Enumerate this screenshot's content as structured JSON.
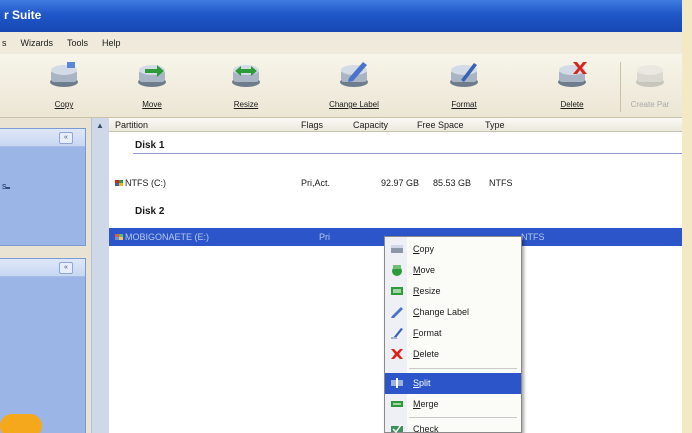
{
  "window": {
    "title": "r Suite"
  },
  "menu": {
    "items": [
      "s",
      "Wizards",
      "Tools",
      "Help"
    ]
  },
  "toolbar": {
    "buttons": [
      {
        "label": "Copy",
        "icon": "copy-icon"
      },
      {
        "label": "Move",
        "icon": "move-icon"
      },
      {
        "label": "Resize",
        "icon": "resize-icon"
      },
      {
        "label": "Change Label",
        "icon": "change-label-icon"
      },
      {
        "label": "Format",
        "icon": "format-icon"
      },
      {
        "label": "Delete",
        "icon": "delete-icon"
      },
      {
        "label": "Create Par",
        "icon": "create-partition-icon",
        "disabled": true
      }
    ]
  },
  "left_panel": {
    "bullet_text": "s",
    "collapse_label": "«"
  },
  "columns": [
    "Partition",
    "Flags",
    "Capacity",
    "Free Space",
    "Type"
  ],
  "disks": [
    {
      "name": "Disk 1",
      "partitions": [
        {
          "name": "NTFS (C:)",
          "flags": "Pri,Act.",
          "capacity": "92.97 GB",
          "free": "85.53 GB",
          "type": "NTFS"
        }
      ]
    },
    {
      "name": "Disk 2",
      "partitions": [
        {
          "name": "MOBIGONAETE (E:)",
          "flags": "Pri",
          "capacity": "",
          "free": "",
          "type": "NTFS"
        }
      ]
    }
  ],
  "context_menu": {
    "items": [
      {
        "label": "Copy",
        "icon": "copy-icon"
      },
      {
        "label": "Move",
        "icon": "move-icon"
      },
      {
        "label": "Resize",
        "icon": "resize-icon"
      },
      {
        "label": "Change Label",
        "icon": "change-label-icon"
      },
      {
        "label": "Format",
        "icon": "format-icon"
      },
      {
        "label": "Delete",
        "icon": "delete-icon"
      },
      {
        "label": "Split",
        "icon": "split-icon",
        "highlighted": true
      },
      {
        "label": "Merge",
        "icon": "merge-icon"
      },
      {
        "label": "Check",
        "icon": "check-icon"
      }
    ]
  },
  "colors": {
    "titlebar": "#1f56c8",
    "selection": "#2b55c8",
    "task_panel": "#9bb6e6",
    "page_background": "#f3e9c4",
    "badge": "#f5a81c"
  }
}
